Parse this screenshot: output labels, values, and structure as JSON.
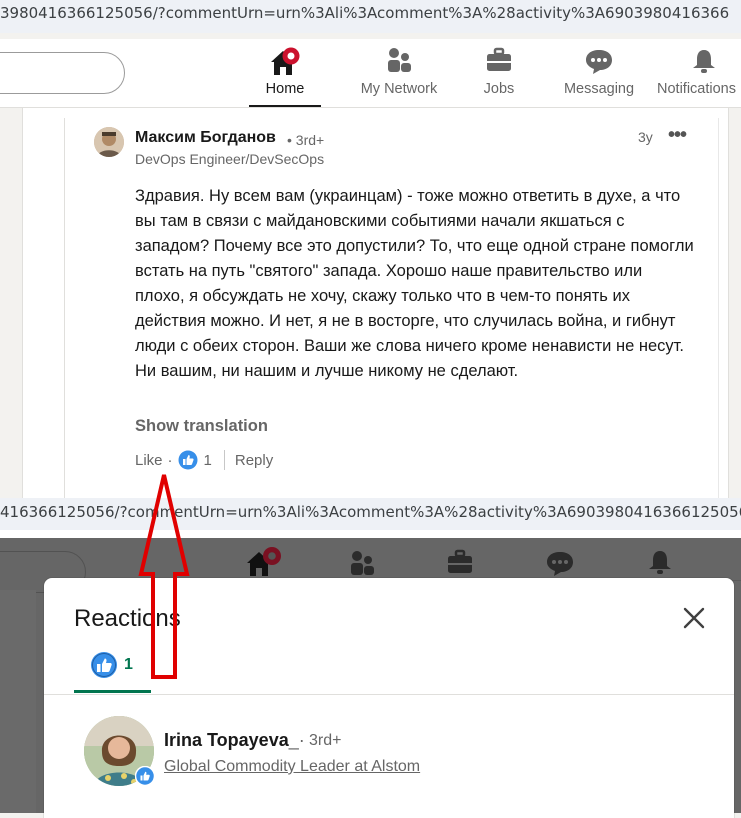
{
  "top_screenshot": {
    "url_text": "3980416366125056/?commentUrn=urn%3Ali%3Acomment%3A%28activity%3A6903980416366",
    "nav": {
      "items": [
        {
          "label": "Home",
          "icon": "home-icon",
          "active": true
        },
        {
          "label": "My Network",
          "icon": "my-network-icon"
        },
        {
          "label": "Jobs",
          "icon": "jobs-icon"
        },
        {
          "label": "Messaging",
          "icon": "messaging-icon"
        },
        {
          "label": "Notifications",
          "icon": "bell-icon"
        }
      ]
    },
    "comment": {
      "author": "Максим Богданов",
      "degree": "• 3rd+",
      "headline": "DevOps Engineer/DevSecOps",
      "time": "3y",
      "more": "•••",
      "text": "Здравия. Ну всем вам (украинцам) - тоже можно ответить в духе, а что вы там в связи с майдановскими событиями начали якшаться с западом? Почему все это допустили? То, что еще одной стране помогли встать на путь \"святого\" запада. Хорошо наше правительство или плохо, я обсуждать не хочу, скажу только что в чем-то понять их действия можно. И нет, я не в восторге, что случилась война, и гибнут люди с обеих сторон. Ваши же слова ничего кроме ненависти не несут. Ни вашим, ни нашим и лучше никому не сделают.",
      "show_translation": "Show translation",
      "like_label": "Like",
      "separator": "·",
      "reaction_count": "1",
      "reply_label": "Reply"
    }
  },
  "bottom_screenshot": {
    "url_text": "416366125056/?commentUrn=urn%3Ali%3Acomment%3A%28activity%3A6903980416366125056",
    "modal": {
      "title": "Reactions",
      "tab_count": "1",
      "close_icon": "close-icon",
      "reactor": {
        "name": "Irina Topayeva",
        "name_suffix": "_·",
        "degree": "3rd+",
        "headline": "Global Commodity Leader at Alstom"
      }
    }
  },
  "colors": {
    "linkedin_green": "#01754f",
    "like_blue": "#378fe9",
    "annotation_red": "#e00000",
    "notification_red": "#cb112d"
  }
}
